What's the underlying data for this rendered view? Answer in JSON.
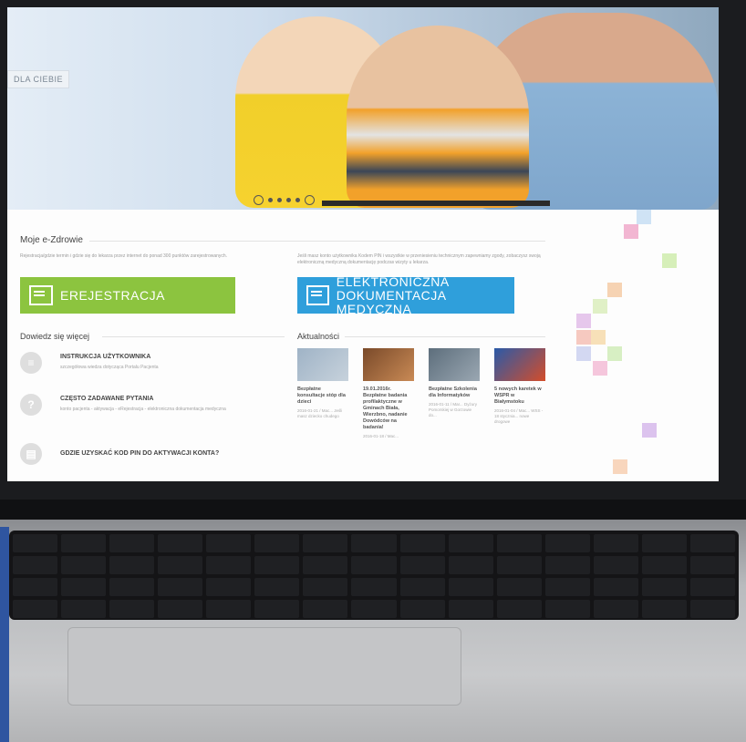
{
  "hero": {
    "tag": "DLA CIEBIE"
  },
  "brand": {
    "green": "#8cc43f",
    "blue": "#2f9fdb"
  },
  "section": {
    "title": "Moje e-Zdrowie",
    "intro_left": "Rejestracja/gdzie termin i gdzie się do lekarza przez internet do ponad 300 punktów zarejestrowanych.",
    "intro_right": "Jeśli masz konto użytkownika Kodem PIN i wszystkie w przeniesieniu technicznym zapewniamy zgody, zobaczysz swoją elektroniczną medyczną dokumentację podczas wizyty u lekarza."
  },
  "buttons": {
    "registration": "EREJESTRACJA",
    "edm_line1": "ELEKTRONICZNA",
    "edm_line2": "DOKUMENTACJA MEDYCZNA"
  },
  "learn_more": {
    "title": "Dowiedz się więcej",
    "items": [
      {
        "title": "INSTRUKCJA UŻYTKOWNIKA",
        "desc": "szczegółowa wiedza dotycząca Portalu Pacjenta",
        "icon_glyph": "≡"
      },
      {
        "title": "CZĘSTO ZADAWANE PYTANIA",
        "desc": "konto pacjenta - aktywacja - eRejestracja - elektroniczna dokumentacja medyczna",
        "icon_glyph": "?"
      },
      {
        "title": "GDZIE UZYSKAĆ KOD PIN DO AKTYWACJI KONTA?",
        "desc": "",
        "icon_glyph": "▤"
      }
    ]
  },
  "news": {
    "title": "Aktualności",
    "items": [
      {
        "title": "Bezpłatne konsultacje stóp dla dzieci",
        "meta": "2016-01-21 / Mac... Jeśli masz dziecko chudego",
        "color1": "#9fb3c6",
        "color2": "#c7d2dc"
      },
      {
        "title": "19.01.2016r. Bezpłatne badania profilaktyczne w Gminach Biała, Wierzbno, nadanie Dowódców na badania!",
        "meta": "2016-01-18 / Mac...",
        "color1": "#7a4a2a",
        "color2": "#c98a55"
      },
      {
        "title": "Bezpłatne Szkolenia dla Informatyków",
        "meta": "2016-01-11 / Mar... Dyżury Pomorskiej w Gorzowie do...",
        "color1": "#5d6e7c",
        "color2": "#9aa7b2"
      },
      {
        "title": "5 nowych karetek w WSPR w Białymstoku",
        "meta": "2016-01-04 / Mac... WSS - 18 stycznia... nowe drogowe",
        "color1": "#2a5aa8",
        "color2": "#d44d2a"
      }
    ]
  }
}
